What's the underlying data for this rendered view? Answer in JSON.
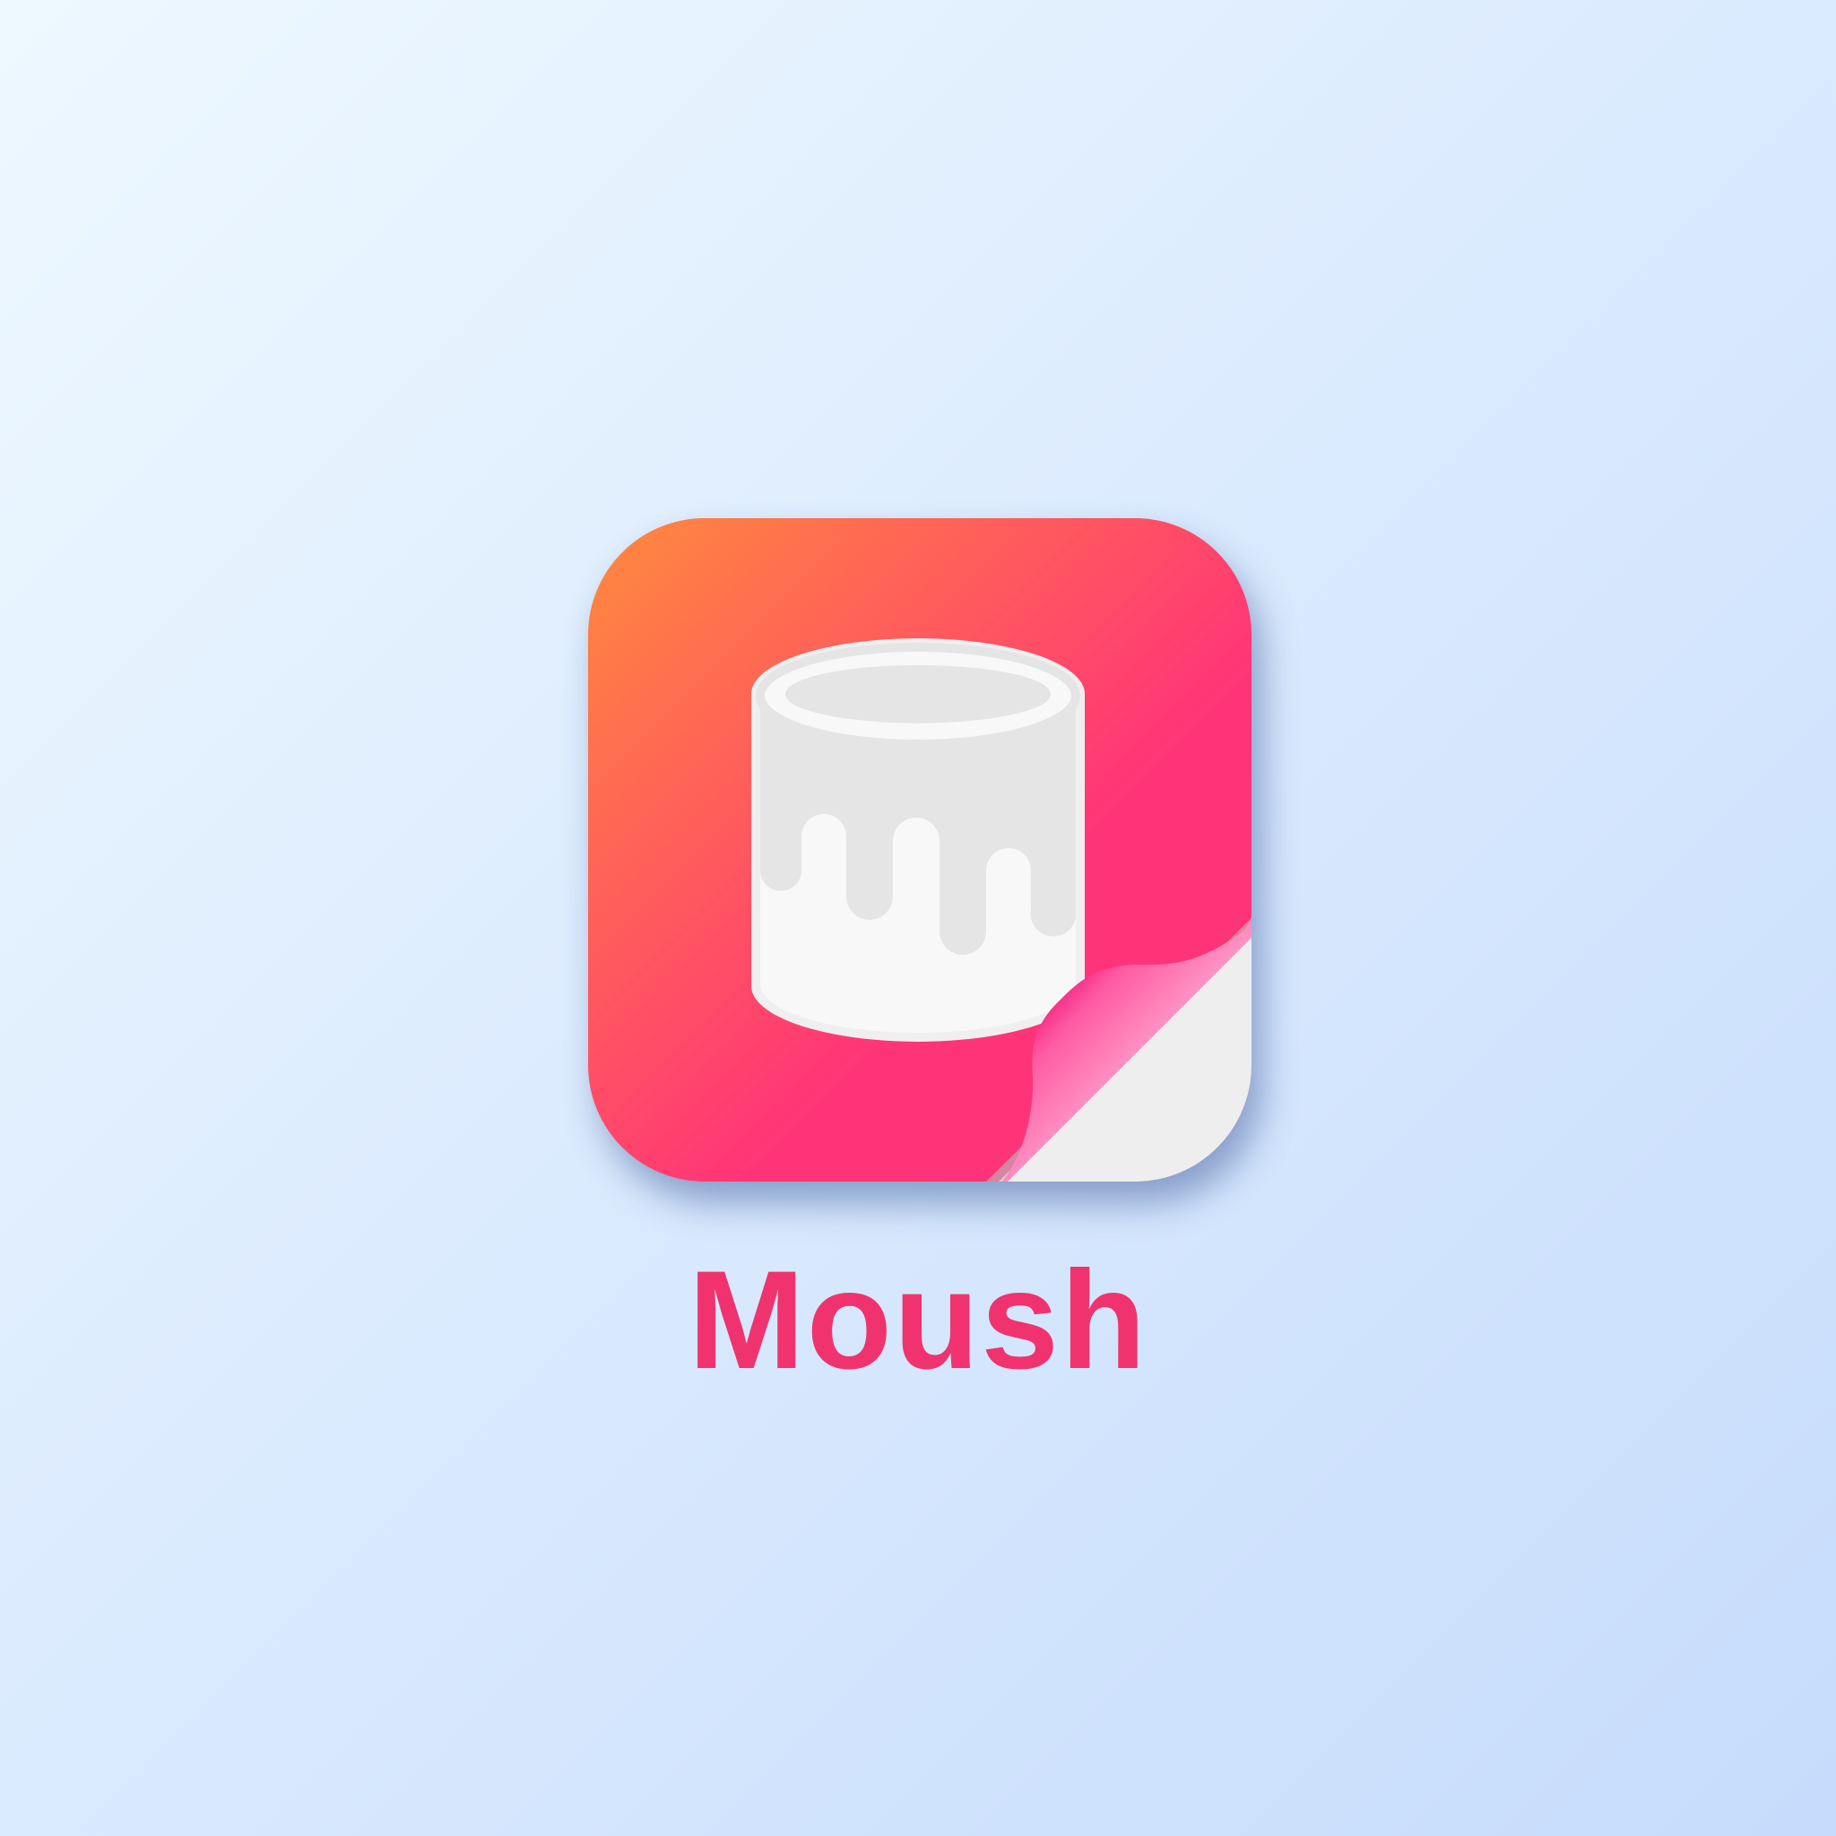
{
  "app": {
    "name": "Moush",
    "icon": "paint-bucket-icon",
    "corner_effect": "page-curl"
  },
  "colors": {
    "background_start": "#eef8ff",
    "background_end": "#c6dcfc",
    "icon_gradient_start": "#ff8a3d",
    "icon_gradient_mid": "#ff5560",
    "icon_gradient_end": "#ff3478",
    "bucket_body": "#e5e5e5",
    "bucket_paint": "#f8f8f8",
    "curl_magenta": "#ee1977",
    "curl_pink_light": "#ff9ac6",
    "peel_back": "#eeeeee",
    "label": "#f0336e"
  }
}
